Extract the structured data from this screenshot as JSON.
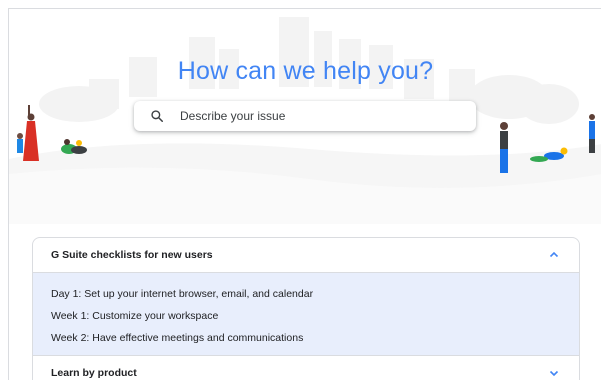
{
  "hero": {
    "title": "How can we help you?",
    "search_placeholder": "Describe your issue",
    "search_icon": "search-icon",
    "accent_color": "#4285f4"
  },
  "sections": [
    {
      "title": "G Suite checklists for new users",
      "expanded": true,
      "chevron": "chevron-up-icon",
      "items": [
        "Day 1: Set up your internet browser, email, and calendar",
        "Week 1: Customize your workspace",
        "Week 2: Have effective meetings and communications"
      ]
    },
    {
      "title": "Learn by product",
      "expanded": false,
      "chevron": "chevron-down-icon"
    }
  ],
  "colors": {
    "expanded_bg": "#e8eefc",
    "border": "#dadce0",
    "chevron": "#4285f4"
  }
}
